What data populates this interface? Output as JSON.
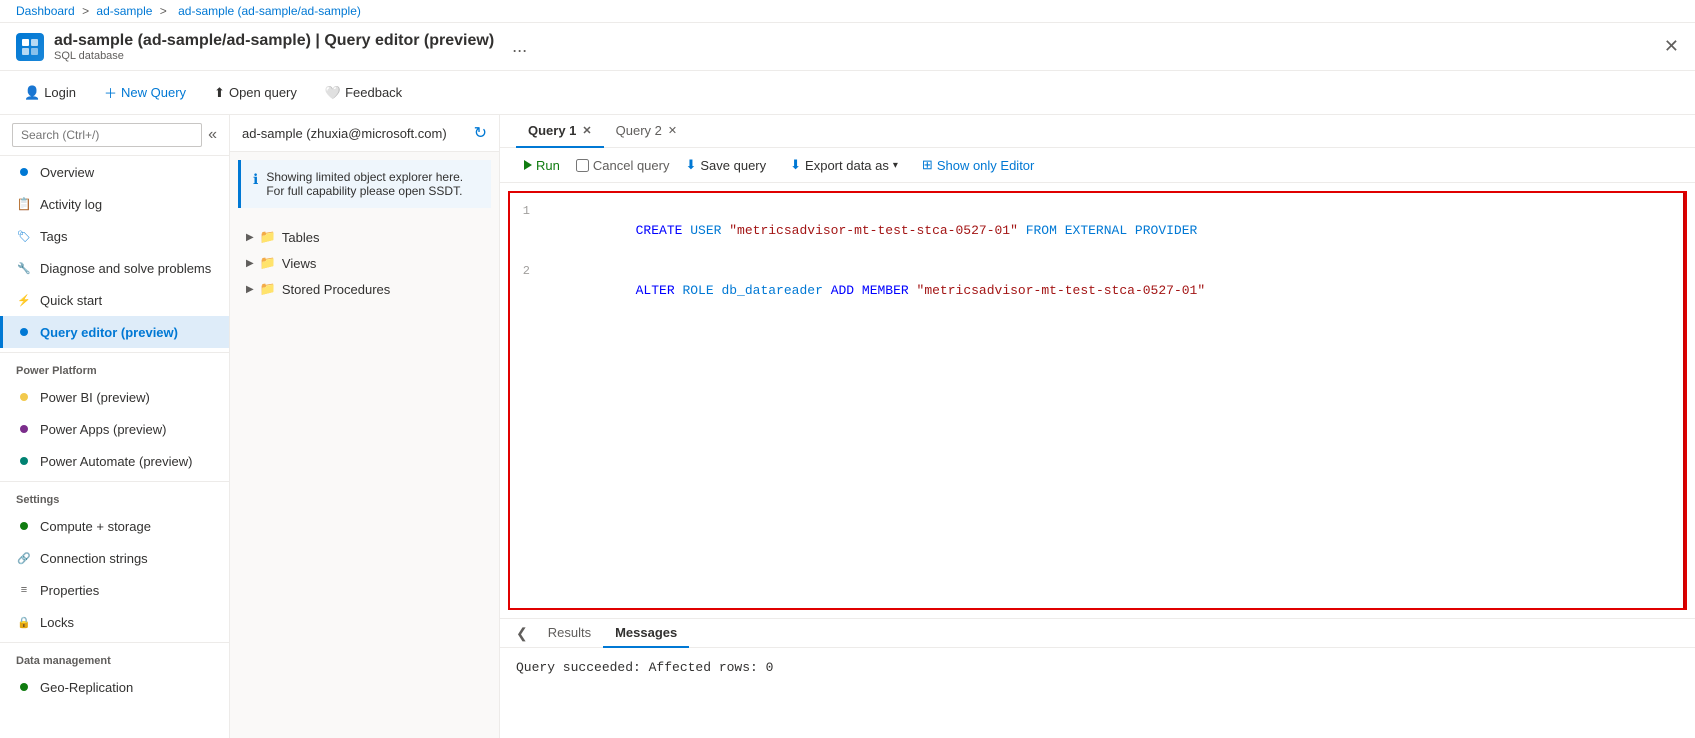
{
  "breadcrumb": {
    "items": [
      "Dashboard",
      "ad-sample",
      "ad-sample (ad-sample/ad-sample)"
    ],
    "separators": [
      ">",
      ">"
    ]
  },
  "header": {
    "title": "ad-sample (ad-sample/ad-sample) | Query editor (preview)",
    "subtitle": "SQL database",
    "more_btn": "...",
    "close_btn": "✕"
  },
  "toolbar": {
    "login_label": "Login",
    "new_query_label": "New Query",
    "open_query_label": "Open query",
    "feedback_label": "Feedback"
  },
  "sidebar": {
    "search_placeholder": "Search (Ctrl+/)",
    "items": [
      {
        "label": "Overview",
        "icon": "overview-icon"
      },
      {
        "label": "Activity log",
        "icon": "activity-icon"
      },
      {
        "label": "Tags",
        "icon": "tags-icon"
      },
      {
        "label": "Diagnose and solve problems",
        "icon": "diagnose-icon"
      },
      {
        "label": "Quick start",
        "icon": "quickstart-icon"
      },
      {
        "label": "Query editor (preview)",
        "icon": "queryeditor-icon",
        "active": true
      }
    ],
    "sections": [
      {
        "label": "Power Platform",
        "items": [
          {
            "label": "Power BI (preview)",
            "icon": "powerbi-icon"
          },
          {
            "label": "Power Apps (preview)",
            "icon": "powerapps-icon"
          },
          {
            "label": "Power Automate (preview)",
            "icon": "powerautomate-icon"
          }
        ]
      },
      {
        "label": "Settings",
        "items": [
          {
            "label": "Compute + storage",
            "icon": "compute-icon"
          },
          {
            "label": "Connection strings",
            "icon": "connection-icon"
          },
          {
            "label": "Properties",
            "icon": "properties-icon"
          },
          {
            "label": "Locks",
            "icon": "locks-icon"
          }
        ]
      },
      {
        "label": "Data management",
        "items": [
          {
            "label": "Geo-Replication",
            "icon": "geo-icon"
          }
        ]
      }
    ]
  },
  "object_explorer": {
    "server_name": "ad-sample (zhuxia@microsoft.com)",
    "refresh_btn": "↻",
    "info_text": "Showing limited object explorer here. For full capability please open SSDT.",
    "tree_items": [
      {
        "label": "Tables",
        "type": "folder"
      },
      {
        "label": "Views",
        "type": "folder"
      },
      {
        "label": "Stored Procedures",
        "type": "folder"
      }
    ]
  },
  "query_editor": {
    "tabs": [
      {
        "label": "Query 1",
        "active": true
      },
      {
        "label": "Query 2",
        "active": false
      }
    ],
    "editor_toolbar": {
      "run": "Run",
      "cancel": "Cancel query",
      "save": "Save query",
      "export": "Export data as",
      "show_editor": "Show only Editor"
    },
    "code_lines": [
      {
        "num": "1",
        "parts": [
          {
            "text": "CREATE",
            "type": "keyword"
          },
          {
            "text": " USER ",
            "type": "plain"
          },
          {
            "text": "\"metricsadvisor-mt-test-stca-0527-01\"",
            "type": "string"
          },
          {
            "text": " FROM EXTERNAL PROVIDER",
            "type": "plain"
          }
        ]
      },
      {
        "num": "2",
        "parts": [
          {
            "text": "ALTER",
            "type": "keyword"
          },
          {
            "text": " ROLE ",
            "type": "plain"
          },
          {
            "text": "db_datareader",
            "type": "plain"
          },
          {
            "text": " ADD MEMBER ",
            "type": "plain"
          },
          {
            "text": "\"metricsadvisor-mt-test-stca-0527-01\"",
            "type": "string"
          }
        ]
      }
    ],
    "results": {
      "tabs": [
        "Results",
        "Messages"
      ],
      "active_tab": "Messages",
      "message": "Query succeeded: Affected rows: 0"
    }
  }
}
